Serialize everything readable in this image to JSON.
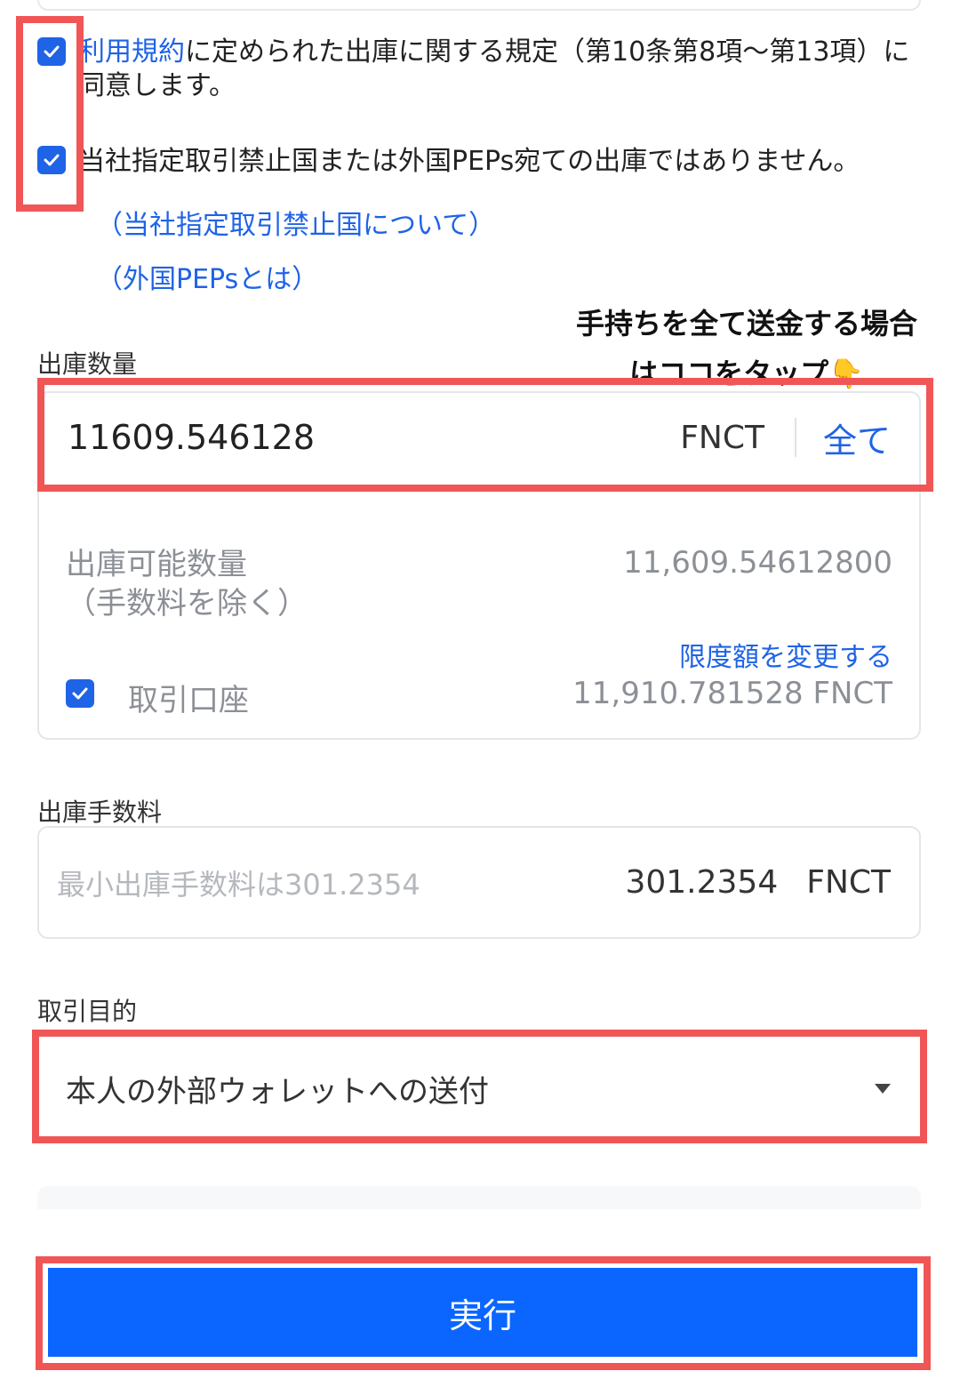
{
  "agreements": {
    "terms_link": "利用規約",
    "terms_text_line1": "に定められた出庫に関する規定（第10条第8項〜第13項）に",
    "terms_text_line2": "同意します。",
    "pep_text": "当社指定取引禁止国または外国PEPs宛ての出庫ではありません。",
    "link_prohibited": "（当社指定取引禁止国について）",
    "link_peps": "（外国PEPsとは）"
  },
  "callout": {
    "line1": "手持ちを全て送金する場合",
    "line2": "はココをタップ",
    "emoji": "👇"
  },
  "amount": {
    "label": "出庫数量",
    "value": "11609.546128",
    "unit": "FNCT",
    "all_button": "全て"
  },
  "available": {
    "label_line1": "出庫可能数量",
    "label_line2": "（手数料を除く）",
    "value": "11,609.54612800",
    "change_limit": "限度額を変更する",
    "account_label": "取引口座",
    "account_value": "11,910.781528 FNCT"
  },
  "fee": {
    "label": "出庫手数料",
    "placeholder": "最小出庫手数料は301.2354",
    "value": "301.2354",
    "unit": "FNCT"
  },
  "purpose": {
    "label": "取引目的",
    "selected": "本人の外部ウォレットへの送付"
  },
  "execute": {
    "label": "実行"
  },
  "colors": {
    "accent": "#1f63e6",
    "button": "#0a66ff",
    "annotation": "#f05656"
  }
}
